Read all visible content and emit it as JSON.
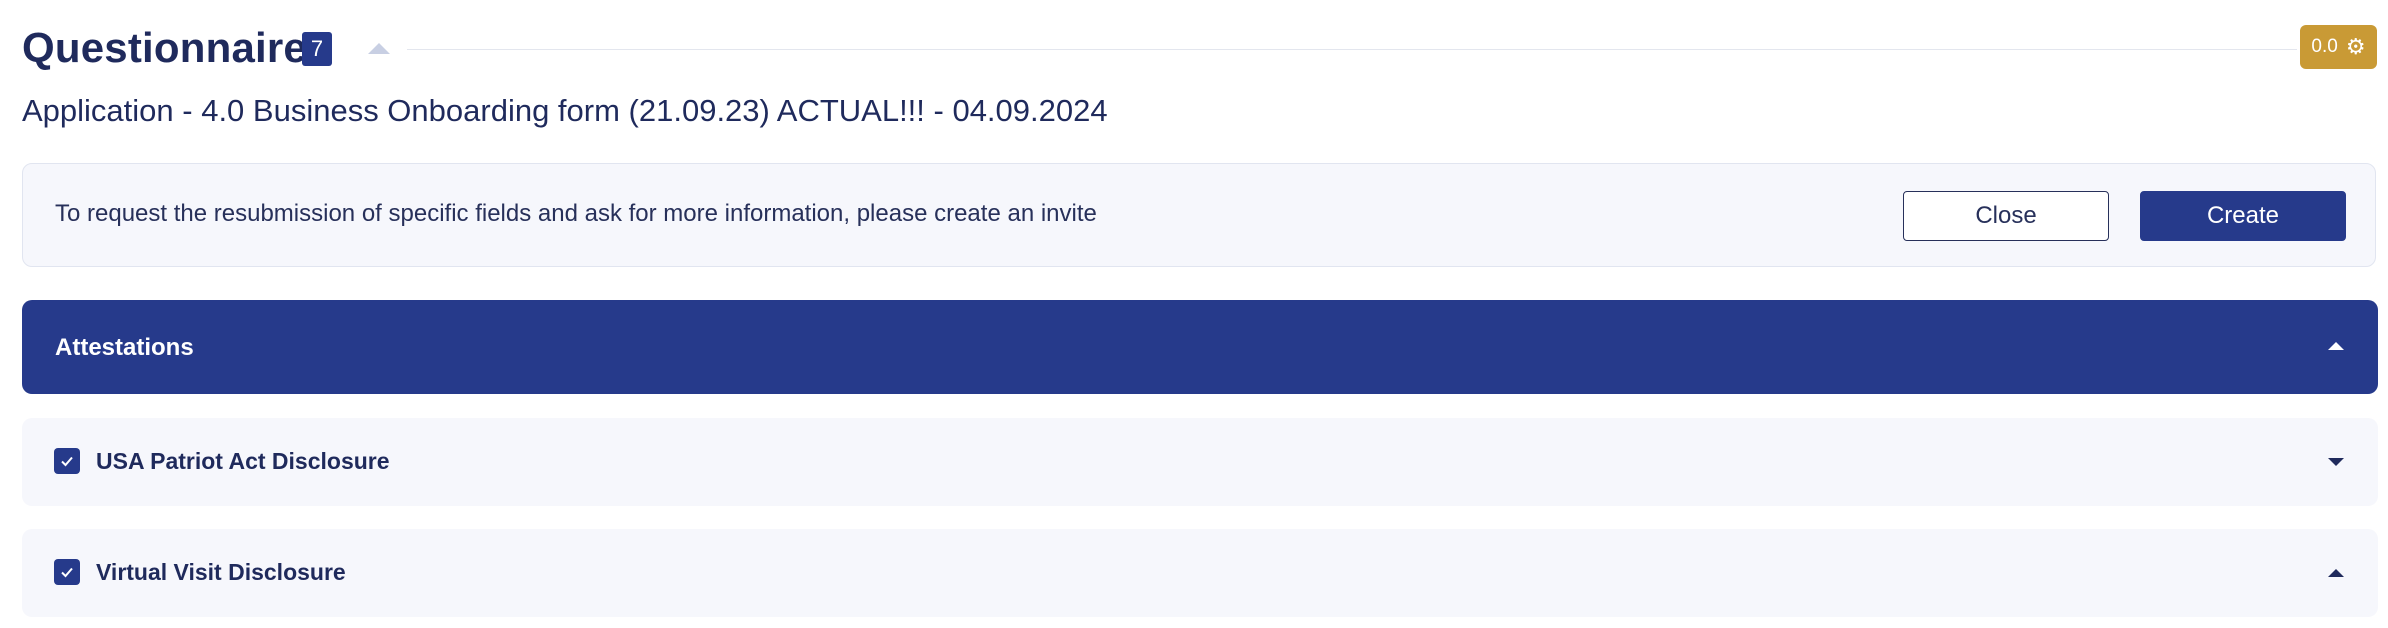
{
  "header": {
    "title": "Questionnaire",
    "count": "7",
    "score": "0.0",
    "collapse_icon": "chevron-up-icon",
    "settings_icon": "gear-icon"
  },
  "subtitle": "Application - 4.0 Business Onboarding form (21.09.23) ACTUAL!!! - 04.09.2024",
  "invite": {
    "message": "To request the resubmission of specific fields and ask for more information, please create an invite",
    "close_label": "Close",
    "create_label": "Create"
  },
  "sections": [
    {
      "title": "Attestations",
      "expanded": true,
      "items": [
        {
          "label": "USA Patriot Act Disclosure",
          "checked": true,
          "expanded": false
        },
        {
          "label": "Virtual Visit Disclosure",
          "checked": true,
          "expanded": true
        }
      ]
    }
  ],
  "colors": {
    "primary": "#263a8b",
    "text": "#1f2a5c",
    "panel_bg": "#f6f7fc",
    "score_badge": "#c99a35"
  }
}
